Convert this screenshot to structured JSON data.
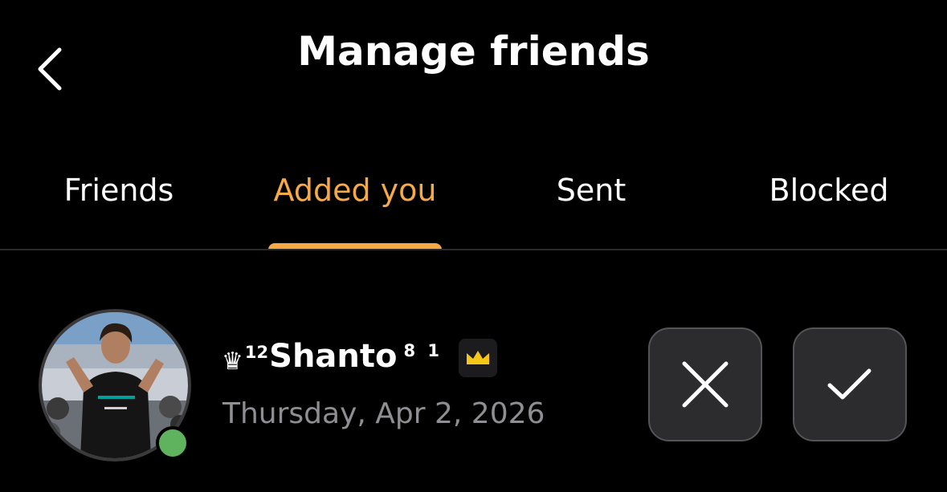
{
  "header": {
    "title": "Manage friends",
    "back_icon": "chevron-left-icon"
  },
  "tabs": [
    {
      "label": "Friends",
      "active": false
    },
    {
      "label": "Added you",
      "active": true
    },
    {
      "label": "Sent",
      "active": false
    },
    {
      "label": "Blocked",
      "active": false
    }
  ],
  "request": {
    "name_prefix_symbol": "♛",
    "name_prefix_superscript": "12",
    "name": "Shanto",
    "name_suffix_superscript": "8 1",
    "badge_icon": "crown-icon",
    "date": "Thursday, Apr 2, 2026",
    "online": true,
    "decline_icon": "close-icon",
    "accept_icon": "checkmark-icon"
  },
  "colors": {
    "background": "#000000",
    "accent": "#f6a945",
    "secondary_text": "#8e8e93",
    "button_bg": "#2c2c2e",
    "online": "#5fb35f",
    "crown": "#f5c518"
  }
}
